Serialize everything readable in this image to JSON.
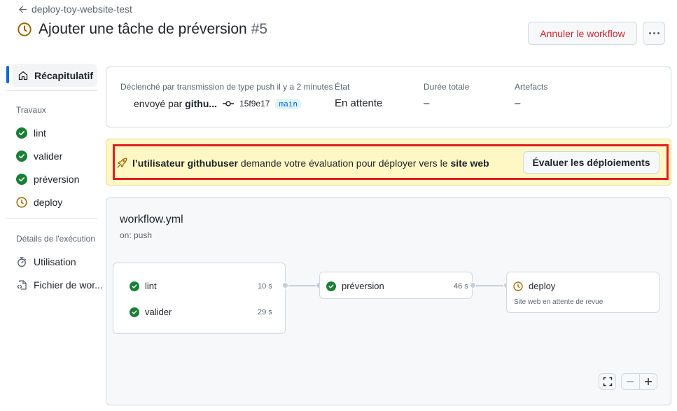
{
  "header": {
    "back_label": "deploy-toy-website-test",
    "title": "Ajouter une tâche de préversion",
    "run_number": "#5",
    "status_icon": "clock-icon",
    "cancel_label": "Annuler le workflow",
    "more_icon": "kebab-horizontal-icon"
  },
  "sidebar": {
    "summary_label": "Récapitulatif",
    "jobs_heading": "Travaux",
    "jobs": [
      {
        "label": "lint",
        "status": "success"
      },
      {
        "label": "valider",
        "status": "success"
      },
      {
        "label": "préversion",
        "status": "success"
      },
      {
        "label": "deploy",
        "status": "waiting"
      }
    ],
    "details_heading": "Détails de l'exécution",
    "details": [
      {
        "label": "Utilisation",
        "icon": "stopwatch-icon"
      },
      {
        "label": "Fichier de wor...",
        "icon": "file-code-icon"
      }
    ]
  },
  "summary": {
    "trigger_label": "Déclenché par transmission de type push il y a 2 minutes",
    "pushed_by_prefix": "envoyé par",
    "actor": "githu...",
    "commit_sha": "15f9e17",
    "branch": "main",
    "status_label": "État",
    "status_value": "En attente",
    "duration_label": "Durée totale",
    "duration_value": "–",
    "artifacts_label": "Artefacts",
    "artifacts_value": "–"
  },
  "banner": {
    "prefix": "l’utilisateur",
    "user": "githubuser",
    "middle": "demande votre évaluation pour déployer vers le",
    "environment": "site web",
    "button_label": "Évaluer les déploiements"
  },
  "workflow": {
    "file": "workflow.yml",
    "trigger": "on: push",
    "jobs": [
      {
        "name": "lint",
        "duration": "10 s",
        "status": "success"
      },
      {
        "name": "valider",
        "duration": "29 s",
        "status": "success"
      },
      {
        "name": "préversion",
        "duration": "46 s",
        "status": "success"
      },
      {
        "name": "deploy",
        "subtext": "Site web en attente de revue",
        "status": "waiting"
      }
    ]
  },
  "colors": {
    "success": "#1a7f37",
    "waiting": "#9a6700",
    "danger": "#d1242f",
    "accent": "#0969da",
    "banner_bg": "#fff8c5",
    "highlight": "#e01e1e"
  }
}
